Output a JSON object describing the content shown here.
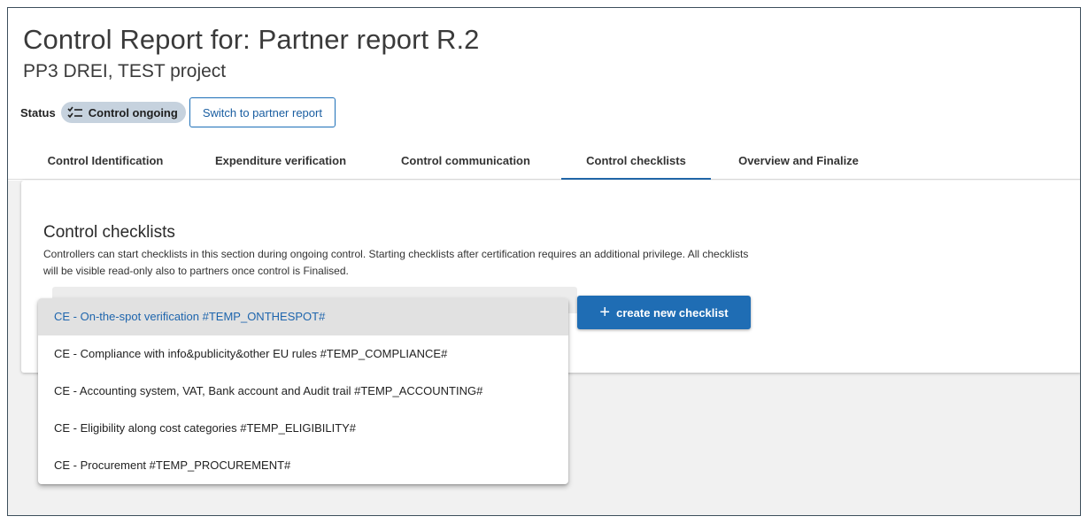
{
  "header": {
    "title": "Control Report for: Partner report R.2",
    "subtitle": "PP3 DREI, TEST project"
  },
  "status": {
    "label": "Status",
    "badge_text": "Control ongoing",
    "badge_icon": "checklist-icon",
    "switch_button": "Switch to partner report"
  },
  "tabs": [
    {
      "label": "Control Identification",
      "active": false
    },
    {
      "label": "Expenditure verification",
      "active": false
    },
    {
      "label": "Control communication",
      "active": false
    },
    {
      "label": "Control checklists",
      "active": true
    },
    {
      "label": "Overview and Finalize",
      "active": false
    }
  ],
  "section": {
    "title": "Control checklists",
    "description": "Controllers can start checklists in this section during ongoing control. Starting checklists after certification requires an additional privilege. All checklists will be visible read-only also to partners once control is Finalised."
  },
  "create_button": {
    "icon": "plus-icon",
    "label": "create new checklist"
  },
  "dropdown": {
    "selected_index": 0,
    "options": [
      "CE - On-the-spot verification #TEMP_ONTHESPOT#",
      "CE - Compliance with info&publicity&other EU rules #TEMP_COMPLIANCE#",
      "CE - Accounting system, VAT, Bank account and Audit trail #TEMP_ACCOUNTING#",
      "CE - Eligibility along cost categories #TEMP_ELIGIBILITY#",
      "CE - Procurement #TEMP_PROCUREMENT#"
    ]
  },
  "colors": {
    "accent": "#1f6db4",
    "status_badge_bg": "#c6d2de",
    "active_tab_underline": "#2166a8",
    "selected_option_text": "#1e65ad"
  }
}
